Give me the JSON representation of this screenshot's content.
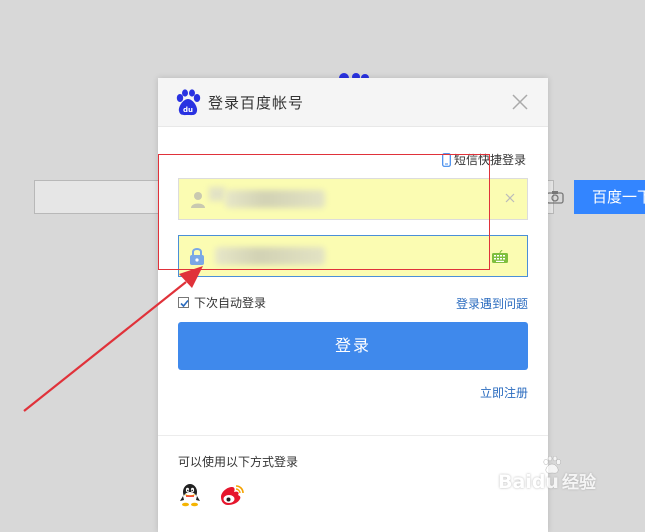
{
  "background": {
    "search_button_label": "百度一下",
    "search_value": ""
  },
  "dialog": {
    "title": "登录百度帐号",
    "sms_login_label": "短信快捷登录",
    "username_value": "",
    "password_value": "",
    "remember_label": "下次自动登录",
    "remember_checked": true,
    "problem_link": "登录遇到问题",
    "login_button": "登录",
    "register_link": "立即注册",
    "other_methods_label": "可以使用以下方式登录",
    "other_methods": [
      "qq-icon",
      "weibo-icon"
    ]
  },
  "watermark": {
    "brand": "Baidu",
    "suffix": "经验"
  },
  "colors": {
    "accent": "#3f89ec",
    "link": "#2a6bbf",
    "autofill": "#fbfcb2",
    "annotation": "#e0323a"
  }
}
